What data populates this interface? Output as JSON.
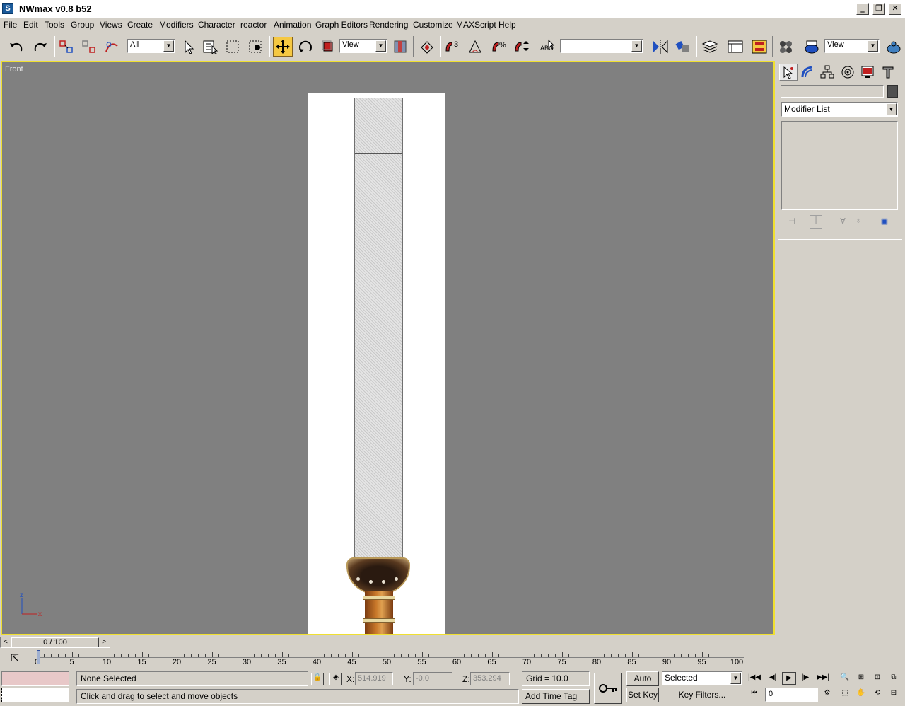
{
  "window": {
    "title": "NWmax v0.8 b52",
    "app_icon": "3ds-max-icon",
    "minimize": "_",
    "restore": "❐",
    "close": "✕"
  },
  "menu": [
    "File",
    "Edit",
    "Tools",
    "Group",
    "Views",
    "Create",
    "Modifiers",
    "Character",
    "reactor",
    "Animation",
    "Graph Editors",
    "Rendering",
    "Customize",
    "MAXScript",
    "Help"
  ],
  "toolbar": {
    "selection_filter": "All",
    "ref_coord": "View",
    "named_selection": "",
    "render_view": "View",
    "accent_active": "#f5c842"
  },
  "viewport": {
    "label": "Front",
    "border_color": "#f0e030",
    "background": "#808080",
    "gizmo_z": "z",
    "gizmo_x": "x"
  },
  "command_panel": {
    "name_value": "",
    "modifier_list": "Modifier List"
  },
  "timeline": {
    "frame_display": "0 / 100",
    "prev": "<",
    "next": ">",
    "ticks": [
      "0",
      "5",
      "10",
      "15",
      "20",
      "25",
      "30",
      "35",
      "40",
      "45",
      "50",
      "55",
      "60",
      "65",
      "70",
      "75",
      "80",
      "85",
      "90",
      "95",
      "100"
    ],
    "current_frame": 0,
    "total_frames": 100
  },
  "status": {
    "selection": "None Selected",
    "prompt": "Click and drag to select and move objects",
    "x_label": "X:",
    "x_value": "514.919",
    "y_label": "Y:",
    "y_value": "-0.0",
    "z_label": "Z:",
    "z_value": "353.294",
    "grid": "Grid = 10.0",
    "add_time_tag": "Add Time Tag",
    "auto_key": "Auto Key",
    "set_key": "Set Key",
    "key_mode": "Selected",
    "key_filters": "Key Filters...",
    "frame_input": "0",
    "maxscript_swatch": "#e8c8c8"
  }
}
